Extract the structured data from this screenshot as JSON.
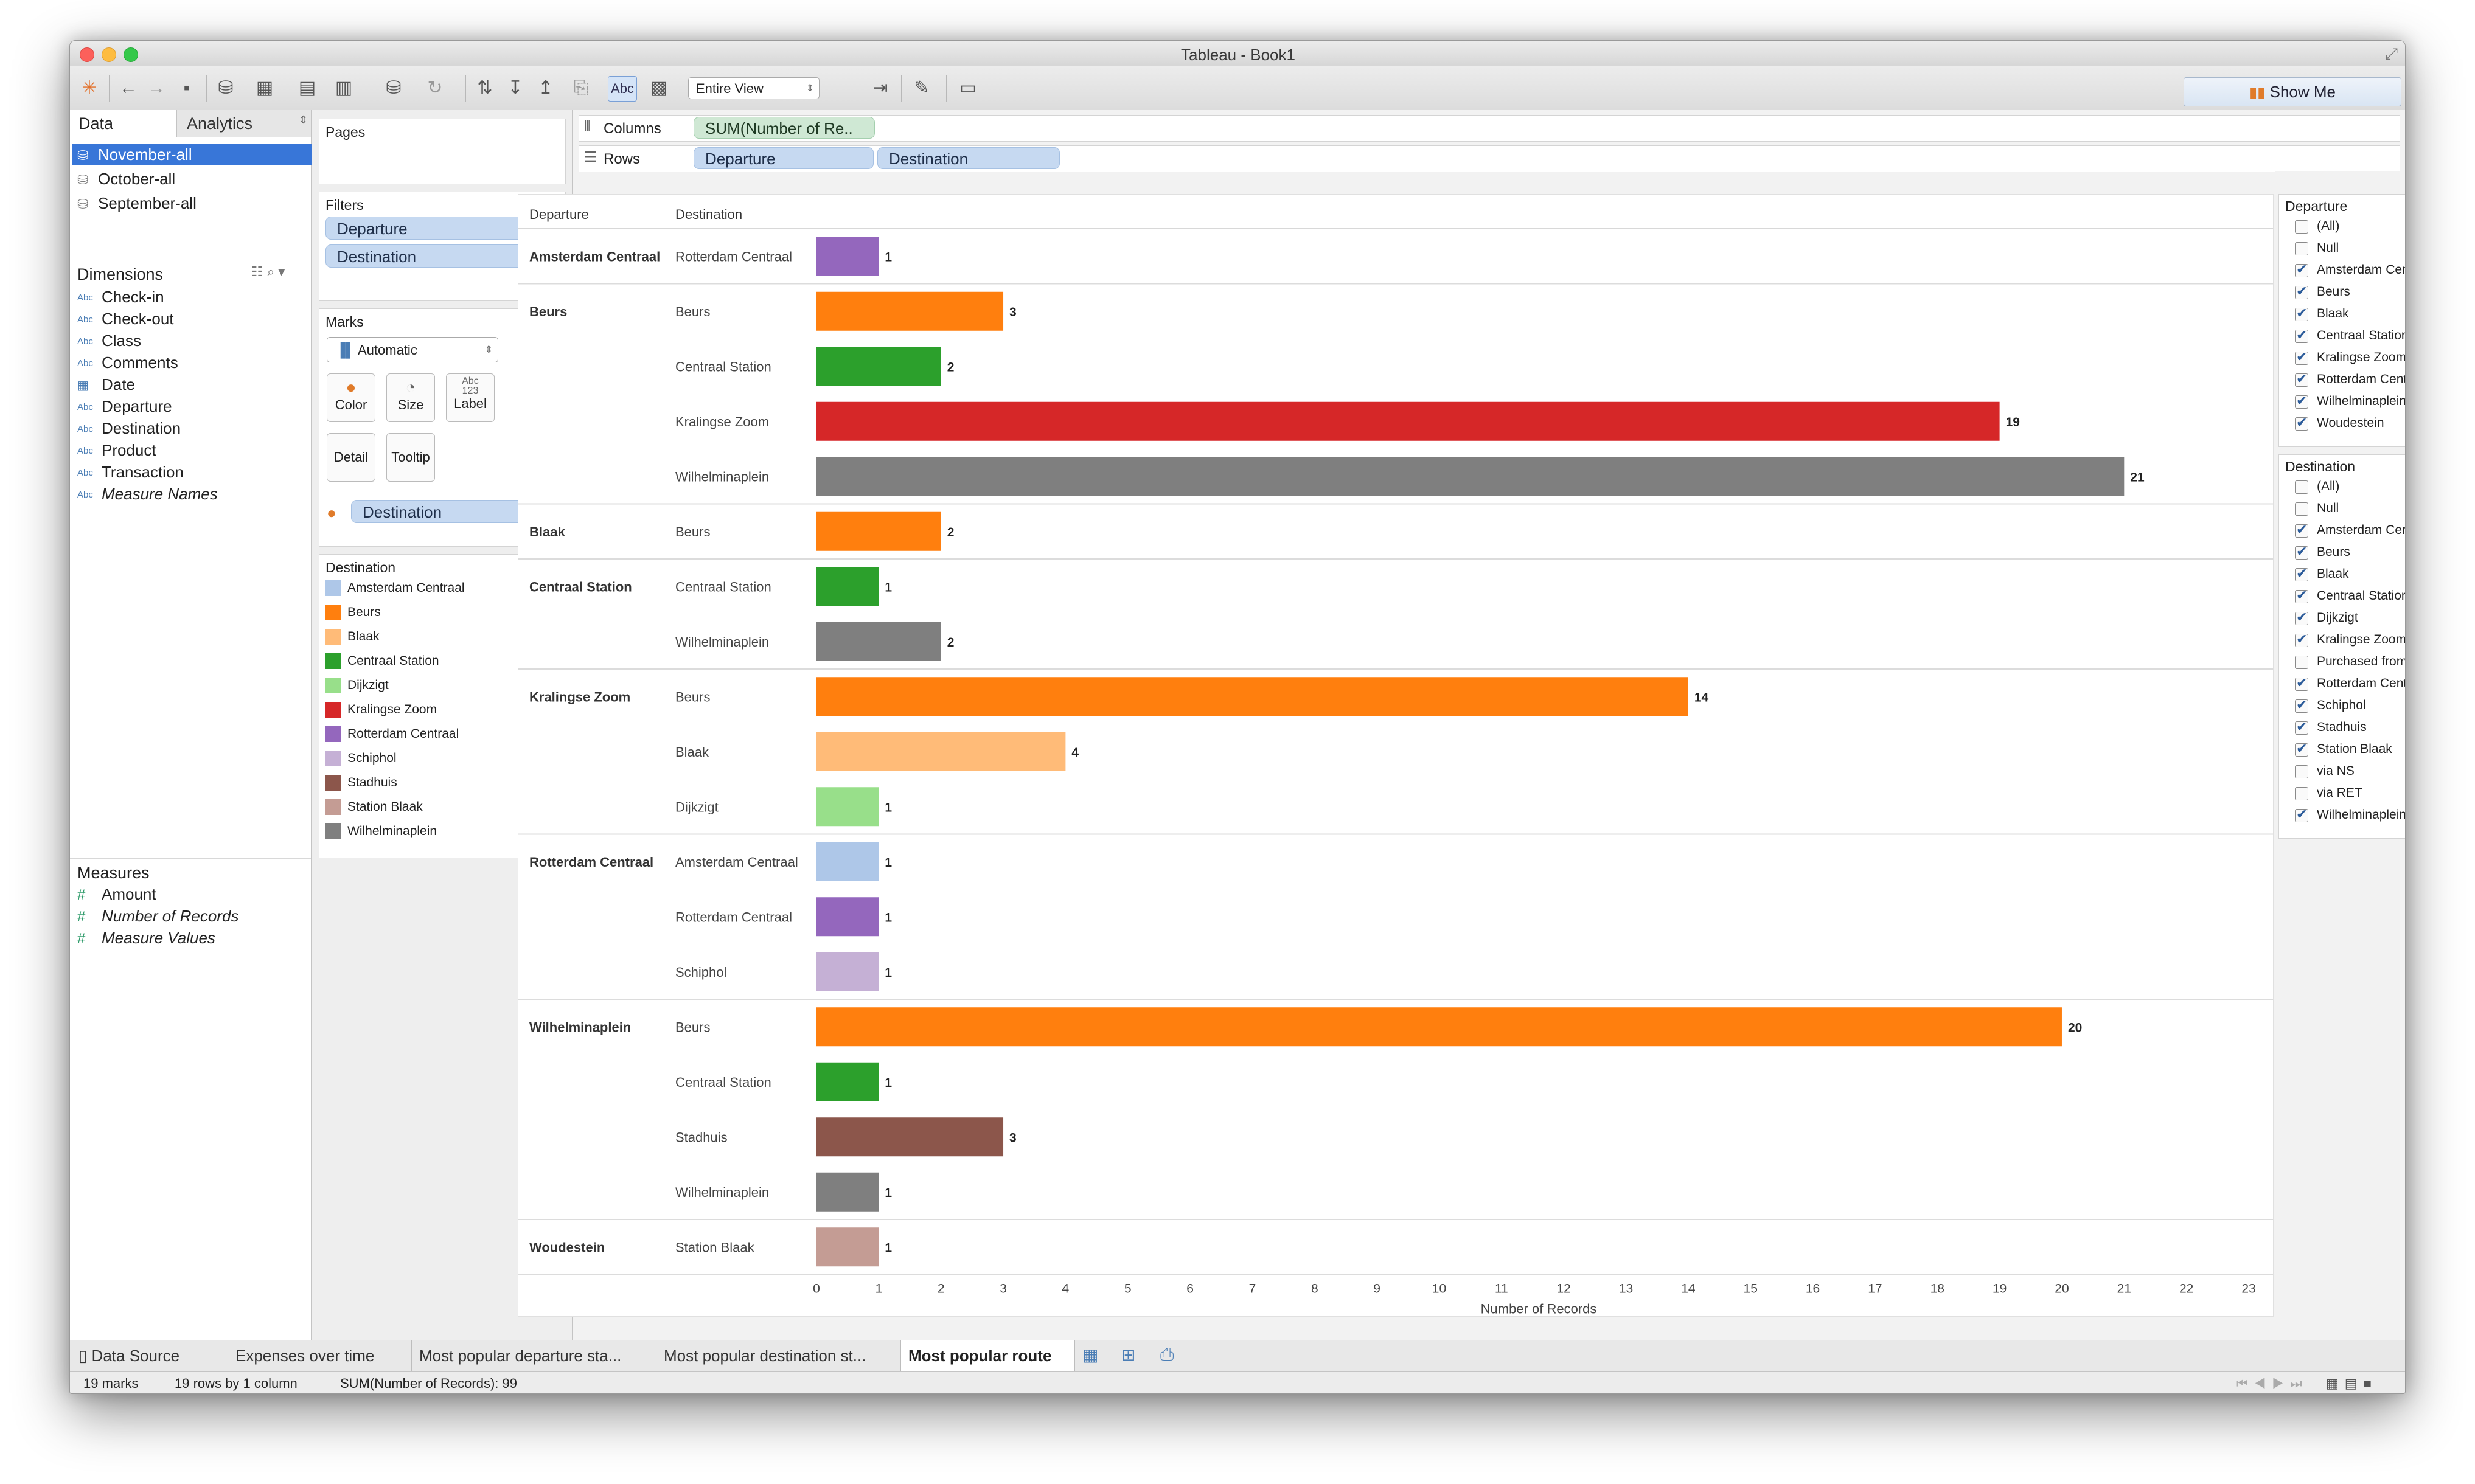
{
  "window": {
    "title": "Tableau - Book1"
  },
  "toolbar": {
    "fit_select": "Entire View",
    "show_me": "Show Me"
  },
  "left_tabs": {
    "data": "Data",
    "analytics": "Analytics"
  },
  "datasources": [
    "November-all",
    "October-all",
    "September-all"
  ],
  "dimensions": {
    "header": "Dimensions",
    "items": [
      {
        "type": "Abc",
        "name": "Check-in"
      },
      {
        "type": "Abc",
        "name": "Check-out"
      },
      {
        "type": "Abc",
        "name": "Class"
      },
      {
        "type": "Abc",
        "name": "Comments"
      },
      {
        "type": "date",
        "name": "Date"
      },
      {
        "type": "Abc",
        "name": "Departure"
      },
      {
        "type": "Abc",
        "name": "Destination"
      },
      {
        "type": "Abc",
        "name": "Product"
      },
      {
        "type": "Abc",
        "name": "Transaction"
      },
      {
        "type": "Abc",
        "name": "Measure Names"
      }
    ]
  },
  "measures": {
    "header": "Measures",
    "items": [
      "Amount",
      "Number of Records",
      "Measure Values"
    ]
  },
  "pages": {
    "label": "Pages"
  },
  "filters": {
    "label": "Filters",
    "items": [
      "Departure",
      "Destination"
    ]
  },
  "marks": {
    "label": "Marks",
    "type": "Automatic",
    "buttons": {
      "color": "Color",
      "size": "Size",
      "label": "Label",
      "detail": "Detail",
      "tooltip": "Tooltip"
    },
    "color_pill": "Destination"
  },
  "legend": {
    "title": "Destination",
    "items": [
      {
        "name": "Amsterdam Centraal",
        "color": "#aec7e8"
      },
      {
        "name": "Beurs",
        "color": "#ff7f0e"
      },
      {
        "name": "Blaak",
        "color": "#ffbb78"
      },
      {
        "name": "Centraal Station",
        "color": "#2ca02c"
      },
      {
        "name": "Dijkzigt",
        "color": "#98df8a"
      },
      {
        "name": "Kralingse Zoom",
        "color": "#d62728"
      },
      {
        "name": "Rotterdam Centraal",
        "color": "#9467bd"
      },
      {
        "name": "Schiphol",
        "color": "#c5b0d5"
      },
      {
        "name": "Stadhuis",
        "color": "#8c564b"
      },
      {
        "name": "Station Blaak",
        "color": "#c49c94"
      },
      {
        "name": "Wilhelminaplein",
        "color": "#7f7f7f"
      }
    ]
  },
  "shelves": {
    "columns_label": "Columns",
    "columns_pill": "SUM(Number of Re..",
    "rows_label": "Rows",
    "rows_pills": [
      "Departure",
      "Destination"
    ]
  },
  "chart_data": {
    "type": "bar",
    "orientation": "horizontal",
    "row_headers": [
      "Departure",
      "Destination"
    ],
    "xlabel": "Number of Records",
    "xlim": [
      0,
      23
    ],
    "ticks": [
      0,
      1,
      2,
      3,
      4,
      5,
      6,
      7,
      8,
      9,
      10,
      11,
      12,
      13,
      14,
      15,
      16,
      17,
      18,
      19,
      20,
      21,
      22,
      23
    ],
    "groups": [
      {
        "departure": "Amsterdam Centraal",
        "rows": [
          {
            "destination": "Rotterdam Centraal",
            "value": 1,
            "color": "#9467bd"
          }
        ]
      },
      {
        "departure": "Beurs",
        "rows": [
          {
            "destination": "Beurs",
            "value": 3,
            "color": "#ff7f0e"
          },
          {
            "destination": "Centraal Station",
            "value": 2,
            "color": "#2ca02c"
          },
          {
            "destination": "Kralingse Zoom",
            "value": 19,
            "color": "#d62728"
          },
          {
            "destination": "Wilhelminaplein",
            "value": 21,
            "color": "#7f7f7f"
          }
        ]
      },
      {
        "departure": "Blaak",
        "rows": [
          {
            "destination": "Beurs",
            "value": 2,
            "color": "#ff7f0e"
          }
        ]
      },
      {
        "departure": "Centraal Station",
        "rows": [
          {
            "destination": "Centraal Station",
            "value": 1,
            "color": "#2ca02c"
          },
          {
            "destination": "Wilhelminaplein",
            "value": 2,
            "color": "#7f7f7f"
          }
        ]
      },
      {
        "departure": "Kralingse Zoom",
        "rows": [
          {
            "destination": "Beurs",
            "value": 14,
            "color": "#ff7f0e"
          },
          {
            "destination": "Blaak",
            "value": 4,
            "color": "#ffbb78"
          },
          {
            "destination": "Dijkzigt",
            "value": 1,
            "color": "#98df8a"
          }
        ]
      },
      {
        "departure": "Rotterdam Centraal",
        "rows": [
          {
            "destination": "Amsterdam Centraal",
            "value": 1,
            "color": "#aec7e8"
          },
          {
            "destination": "Rotterdam Centraal",
            "value": 1,
            "color": "#9467bd"
          },
          {
            "destination": "Schiphol",
            "value": 1,
            "color": "#c5b0d5"
          }
        ]
      },
      {
        "departure": "Wilhelminaplein",
        "rows": [
          {
            "destination": "Beurs",
            "value": 20,
            "color": "#ff7f0e"
          },
          {
            "destination": "Centraal Station",
            "value": 1,
            "color": "#2ca02c"
          },
          {
            "destination": "Stadhuis",
            "value": 3,
            "color": "#8c564b"
          },
          {
            "destination": "Wilhelminaplein",
            "value": 1,
            "color": "#7f7f7f"
          }
        ]
      },
      {
        "departure": "Woudestein",
        "rows": [
          {
            "destination": "Station Blaak",
            "value": 1,
            "color": "#c49c94"
          }
        ]
      }
    ]
  },
  "filter_departure": {
    "title": "Departure",
    "items": [
      {
        "name": "(All)",
        "checked": false
      },
      {
        "name": "Null",
        "checked": false
      },
      {
        "name": "Amsterdam Centraal",
        "checked": true
      },
      {
        "name": "Beurs",
        "checked": true
      },
      {
        "name": "Blaak",
        "checked": true
      },
      {
        "name": "Centraal Station",
        "checked": true
      },
      {
        "name": "Kralingse Zoom",
        "checked": true
      },
      {
        "name": "Rotterdam Centraal",
        "checked": true
      },
      {
        "name": "Wilhelminaplein",
        "checked": true
      },
      {
        "name": "Woudestein",
        "checked": true
      }
    ]
  },
  "filter_destination": {
    "title": "Destination",
    "items": [
      {
        "name": "(All)",
        "checked": false
      },
      {
        "name": "Null",
        "checked": false
      },
      {
        "name": "Amsterdam Centraal",
        "checked": true
      },
      {
        "name": "Beurs",
        "checked": true
      },
      {
        "name": "Blaak",
        "checked": true
      },
      {
        "name": "Centraal Station",
        "checked": true
      },
      {
        "name": "Dijkzigt",
        "checked": true
      },
      {
        "name": "Kralingse Zoom",
        "checked": true
      },
      {
        "name": "Purchased from NS",
        "checked": false
      },
      {
        "name": "Rotterdam Centraal",
        "checked": true
      },
      {
        "name": "Schiphol",
        "checked": true
      },
      {
        "name": "Stadhuis",
        "checked": true
      },
      {
        "name": "Station Blaak",
        "checked": true
      },
      {
        "name": "via NS",
        "checked": false
      },
      {
        "name": "via RET",
        "checked": false
      },
      {
        "name": "Wilhelminaplein",
        "checked": true
      }
    ]
  },
  "sheet_tabs": [
    "Data Source",
    "Expenses over time",
    "Most popular departure sta...",
    "Most popular destination st...",
    "Most popular route"
  ],
  "status": {
    "marks": "19 marks",
    "rows": "19 rows by 1 column",
    "sum": "SUM(Number of Records): 99"
  }
}
